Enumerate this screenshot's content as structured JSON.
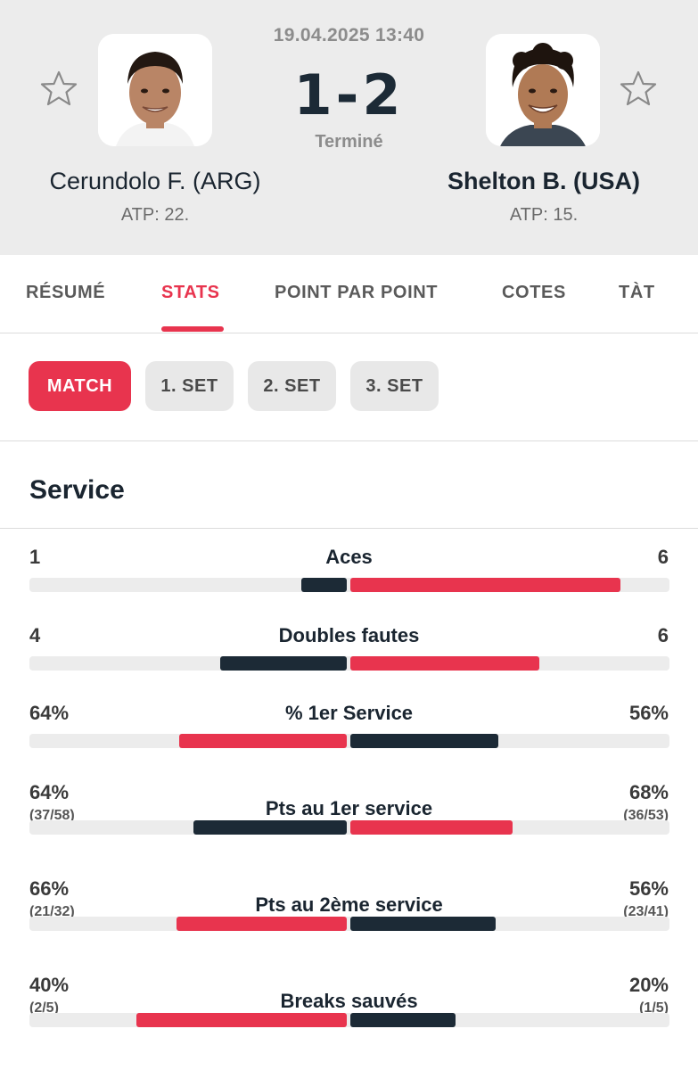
{
  "match": {
    "datetime": "19.04.2025 13:40",
    "score": "1-2",
    "status": "Terminé"
  },
  "players": {
    "left": {
      "name": "Cerundolo F. (ARG)",
      "rank": "ATP: 22."
    },
    "right": {
      "name": "Shelton B. (USA)",
      "rank": "ATP: 15."
    }
  },
  "tabs": [
    {
      "label": "RÉSUMÉ",
      "active": false
    },
    {
      "label": "STATS",
      "active": true
    },
    {
      "label": "POINT PAR POINT",
      "active": false
    },
    {
      "label": "COTES",
      "active": false
    },
    {
      "label": "TÀT",
      "active": false
    }
  ],
  "filters": [
    {
      "label": "MATCH",
      "active": true
    },
    {
      "label": "1. SET",
      "active": false
    },
    {
      "label": "2. SET",
      "active": false
    },
    {
      "label": "3. SET",
      "active": false
    }
  ],
  "section": {
    "title": "Service"
  },
  "colors": {
    "accent": "#e8344e",
    "dark": "#1c2a36",
    "track": "#ececec"
  },
  "icons": {
    "favorite": "star-outline-icon"
  },
  "chart_data": {
    "type": "bar",
    "orientation": "horizontal-diverging",
    "stats": [
      {
        "label": "Aces",
        "left": "1",
        "right": "6",
        "left_sub": "",
        "right_sub": "",
        "left_share": 0.143,
        "right_share": 0.857,
        "leader": "right"
      },
      {
        "label": "Doubles fautes",
        "left": "4",
        "right": "6",
        "left_sub": "",
        "right_sub": "",
        "left_share": 0.4,
        "right_share": 0.6,
        "leader": "right"
      },
      {
        "label": "% 1er Service",
        "left": "64%",
        "right": "56%",
        "left_sub": "",
        "right_sub": "",
        "left_share": 0.53,
        "right_share": 0.47,
        "leader": "left"
      },
      {
        "label": "Pts au 1er service",
        "left": "64%",
        "right": "68%",
        "left_sub": "(37/58)",
        "right_sub": "(36/53)",
        "left_share": 0.485,
        "right_share": 0.515,
        "leader": "right"
      },
      {
        "label": "Pts au 2ème service",
        "left": "66%",
        "right": "56%",
        "left_sub": "(21/32)",
        "right_sub": "(23/41)",
        "left_share": 0.54,
        "right_share": 0.46,
        "leader": "left"
      },
      {
        "label": "Breaks sauvés",
        "left": "40%",
        "right": "20%",
        "left_sub": "(2/5)",
        "right_sub": "(1/5)",
        "left_share": 0.667,
        "right_share": 0.333,
        "leader": "left"
      }
    ]
  }
}
